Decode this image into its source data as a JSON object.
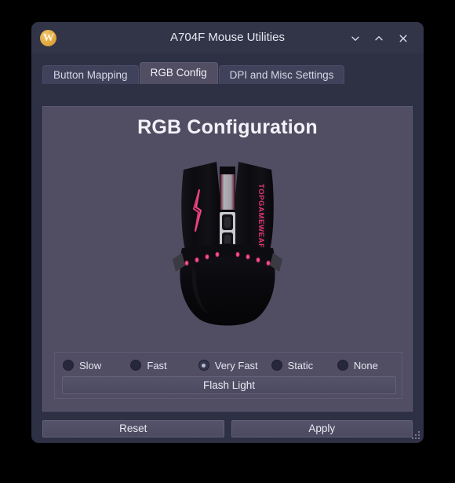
{
  "window": {
    "title": "A704F Mouse Utilities",
    "app_icon": "w-logo-icon",
    "icon_letter": "W",
    "controls": {
      "minimize": "chevron-down-icon",
      "maximize": "chevron-up-icon",
      "close": "close-icon"
    }
  },
  "tabs": [
    {
      "label": "Button Mapping",
      "active": false
    },
    {
      "label": "RGB Config",
      "active": true
    },
    {
      "label": "DPI and Misc Settings",
      "active": false
    }
  ],
  "main": {
    "page_title": "RGB Configuration",
    "device_image": {
      "alt": "gaming-mouse-top-view",
      "brand_text": "TOPGAMEWEAPON",
      "led_color": "#e8417f",
      "body_color": "#0d0c10"
    }
  },
  "effects": {
    "options": [
      {
        "label": "Slow",
        "selected": false
      },
      {
        "label": "Fast",
        "selected": false
      },
      {
        "label": "Very Fast",
        "selected": true
      },
      {
        "label": "Static",
        "selected": false
      },
      {
        "label": "None",
        "selected": false
      }
    ],
    "flash_light_label": "Flash Light"
  },
  "footer": {
    "reset_label": "Reset",
    "apply_label": "Apply"
  },
  "colors": {
    "desktop_background": "#000000",
    "window_background": "#2e3044",
    "titlebar": "#323447",
    "panel": "#514e63",
    "tab_inactive": "#40415a",
    "text_primary": "#e6e8f2",
    "accent_icon": "#e0a93f"
  }
}
